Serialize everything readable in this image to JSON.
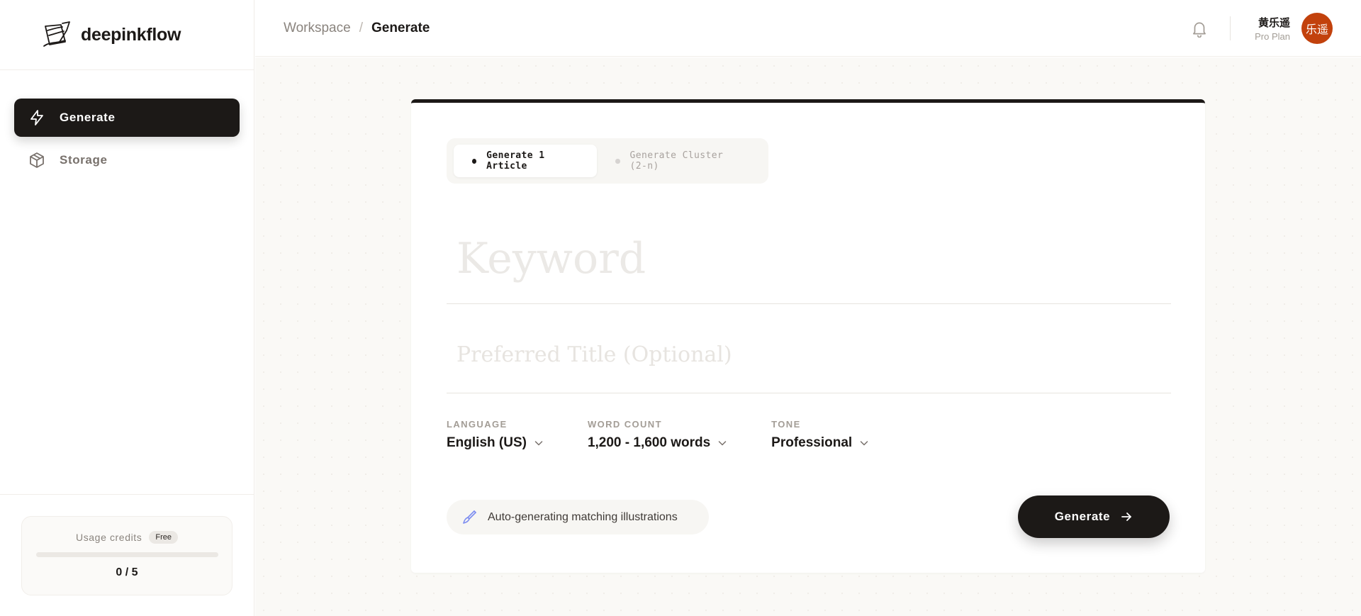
{
  "brand": {
    "name": "deepinkflow",
    "logo_icon": "quill-logo-icon"
  },
  "sidebar": {
    "items": [
      {
        "label": "Generate",
        "icon": "lightning-icon",
        "active": true
      },
      {
        "label": "Storage",
        "icon": "box-icon",
        "active": false
      }
    ],
    "credits": {
      "label": "Usage credits",
      "plan_badge": "Free",
      "count": "0 / 5",
      "fraction": 0
    }
  },
  "header": {
    "breadcrumb": {
      "root": "Workspace",
      "separator": "/",
      "current": "Generate"
    },
    "user": {
      "name": "黄乐遥",
      "plan": "Pro Plan",
      "avatar_text": "乐遥",
      "avatar_color": "#c2410c"
    }
  },
  "main": {
    "mode_tabs": [
      {
        "label": "Generate 1 Article",
        "active": true
      },
      {
        "label": "Generate Cluster (2-n)",
        "active": false
      }
    ],
    "keyword": {
      "placeholder": "Keyword",
      "value": ""
    },
    "preferred_title": {
      "placeholder": "Preferred Title (Optional)",
      "value": ""
    },
    "options": {
      "language": {
        "label": "LANGUAGE",
        "value": "English (US)"
      },
      "word_count": {
        "label": "WORD COUNT",
        "value": "1,200 - 1,600 words"
      },
      "tone": {
        "label": "TONE",
        "value": "Professional"
      }
    },
    "illustrations_note": "Auto-generating matching illustrations",
    "generate_button": "Generate"
  },
  "colors": {
    "primary": "#1c1917",
    "accent_brush": "#7c8cf0",
    "canvas": "#faf9f6"
  }
}
